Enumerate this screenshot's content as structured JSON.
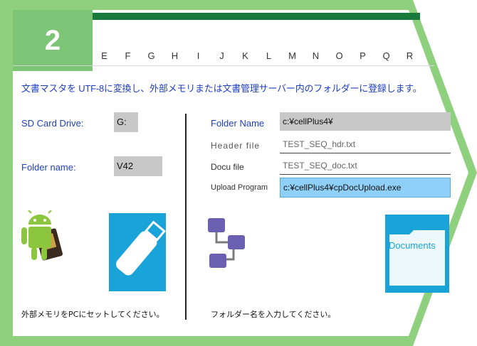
{
  "step": {
    "number": "2"
  },
  "columns": [
    "E",
    "F",
    "G",
    "H",
    "I",
    "J",
    "K",
    "L",
    "M",
    "N",
    "O",
    "P",
    "Q",
    "R"
  ],
  "description": "文書マスタを UTF-8に変換し、外部メモリまたは文書管理サーバー内のフォルダーに登録します。",
  "left": {
    "sd_card_label": "SD Card Drive:",
    "sd_card_value": "G:",
    "folder_label": "Folder name:",
    "folder_value": "V42",
    "note": "外部メモリをPCにセットしてください。"
  },
  "right": {
    "folder_name_label": "Folder Name",
    "folder_name_value": "c:¥cellPlus4¥",
    "header_file_label": "Header file",
    "header_file_value": "TEST_SEQ_hdr.txt",
    "docu_file_label": "Docu file",
    "docu_file_value": "TEST_SEQ_doc.txt",
    "upload_label": "Upload Program",
    "upload_value": "c:¥cellPlus4¥cpDocUpload.exe",
    "documents_label": "Documents",
    "note": "フォルダー名を入力してください。"
  },
  "colors": {
    "badge": "#7cc576",
    "frame": "#8fd07f",
    "accent": "#1f3fbf",
    "upload_bg": "#8fd0f8",
    "usb_bg": "#1aa3d8"
  }
}
